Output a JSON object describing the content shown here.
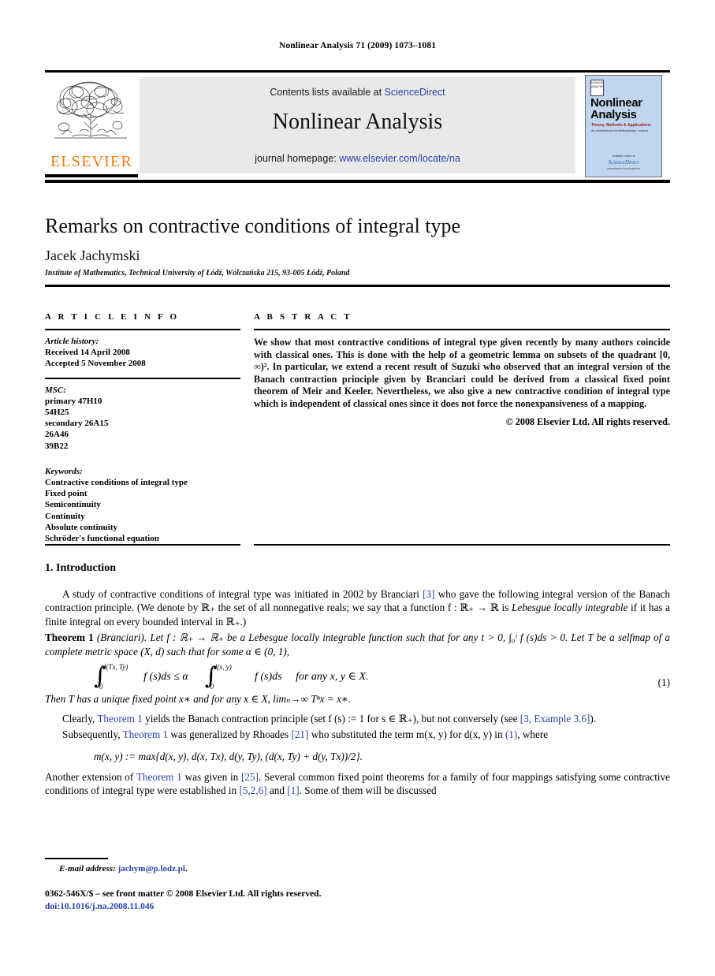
{
  "running_head": "Nonlinear Analysis 71 (2009) 1073–1081",
  "masthead": {
    "publisher_name": "ELSEVIER",
    "contents_prefix": "Contents lists available at ",
    "contents_link": "ScienceDirect",
    "journal_title": "Nonlinear Analysis",
    "homepage_prefix": "journal homepage: ",
    "homepage_link": "www.elsevier.com/locate/na",
    "cover": {
      "badge_text": "NONLINEAR ANALYSIS",
      "title": "Nonlinear Analysis",
      "subtitle_red": "Theory, Methods & Applications",
      "subtitle_small": "An International Multidisciplinary Journal",
      "footer_small": "Available online at",
      "footer_brand": "ScienceDirect",
      "footer_tiny": "www.elsevier.com/locate/na"
    },
    "link_color": "#2b43a8",
    "brand_color": "#f07d13",
    "band_color": "#e9e9e9",
    "cover_color": "#bfd6ee"
  },
  "article": {
    "title": "Remarks on contractive conditions of integral type",
    "author": "Jacek Jachymski",
    "affiliation": "Institute of Mathematics, Technical University of Łódź, Wólczańska 215, 93-005 Łódź, Poland"
  },
  "info": {
    "heading": "A R T I C L E    I N F O",
    "history_label": "Article history:",
    "received": "Received 14 April 2008",
    "accepted": "Accepted 5 November 2008",
    "msc_label": "MSC:",
    "msc": [
      "primary 47H10",
      "54H25",
      "secondary 26A15",
      "26A46",
      "39B22"
    ],
    "keywords_label": "Keywords:",
    "keywords": [
      "Contractive conditions of integral type",
      "Fixed point",
      "Semicontinuity",
      "Continuity",
      "Absolute continuity",
      "Schröder's functional equation"
    ]
  },
  "abstract": {
    "heading": "A B S T R A C T",
    "text": "We show that most contractive conditions of integral type given recently by many authors coincide with classical ones. This is done with the help of a geometric lemma on subsets of the quadrant [0, ∞)². In particular, we extend a recent result of Suzuki who observed that an integral version of the Banach contraction principle given by Branciari could be derived from a classical fixed point theorem of Meir and Keeler. Nevertheless, we also give a new contractive condition of integral type which is independent of classical ones since it does not force the nonexpansiveness of a mapping.",
    "copyright": "© 2008 Elsevier Ltd. All rights reserved."
  },
  "body": {
    "section_number_title": "1. Introduction",
    "para1_a": "A study of contractive conditions of integral type was initiated in 2002 by Branciari ",
    "para1_ref": "[3]",
    "para1_b": " who gave the following integral version of the Banach contraction principle. (We denote by ℝ₊ the set of all nonnegative reals; we say that a function f : ℝ₊ → ℝ is ",
    "para1_ital": "Lebesgue locally integrable",
    "para1_c": " if it has a finite integral on every bounded interval in ℝ₊.)",
    "theorem_name": "Theorem 1",
    "theorem_attr": "(Branciari).",
    "theorem_text_a": " Let f : ℝ₊ → ℝ₊ be a Lebesgue locally integrable function such that for any t > 0, ",
    "theorem_int": "∫₀ᵗ f (s)ds > 0.",
    "theorem_text_b": " Let T be a selfmap of a complete metric space (X, d) such that for some α ∈ (0, 1),",
    "eq1": {
      "upper_left": "d(Tx, Ty)",
      "lower_left": "0",
      "integrand_left": "f (s)ds ≤ α",
      "upper_right": "d(x, y)",
      "lower_right": "0",
      "integrand_right": "f (s)ds",
      "condition": "for any x, y ∈ X.",
      "number": "(1)"
    },
    "after_eq1": "Then T has a unique fixed point x∗ and for any x ∈ X, limₙ→∞ Tⁿx = x∗.",
    "para2_a": "Clearly, ",
    "para2_ref1": "Theorem 1",
    "para2_b": " yields the Banach contraction principle (set f (s)  :=  1 for s ∈ ℝ₊), but not conversely (see ",
    "para2_ref2": "[3, Example 3.6]",
    "para2_c": ").",
    "para3_a": "Subsequently, ",
    "para3_ref1": "Theorem 1",
    "para3_b": " was generalized by Rhoades ",
    "para3_ref2": "[21]",
    "para3_c": " who substituted the term m(x, y) for d(x, y) in ",
    "para3_ref3": "(1)",
    "para3_d": ", where",
    "eq2": "m(x, y) := max{d(x, y), d(x, Tx), d(y, Ty), (d(x, Ty) + d(y, Tx))/2}.",
    "para4_a": "Another extension of ",
    "para4_ref1": "Theorem 1",
    "para4_b": " was given in ",
    "para4_ref2": "[25]",
    "para4_c": ". Several common fixed point theorems for a family of four mappings satisfying some contractive conditions of integral type were established in ",
    "para4_ref3": "[5,2,6]",
    "para4_d": " and ",
    "para4_ref4": "[1]",
    "para4_e": ". Some of them will be discussed"
  },
  "footer": {
    "email_label": "E-mail address:",
    "email": "jachym@p.lodz.pl",
    "email_suffix": ".",
    "issn_line": "0362-546X/$ – see front matter © 2008 Elsevier Ltd. All rights reserved.",
    "doi_line": "doi:10.1016/j.na.2008.11.046"
  }
}
